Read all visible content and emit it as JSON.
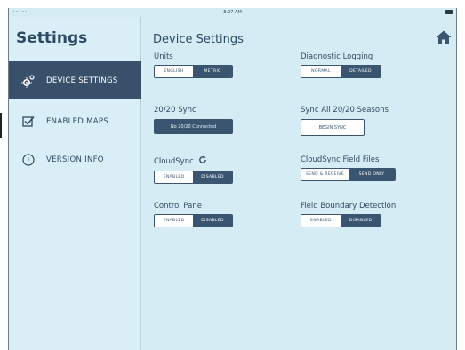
{
  "status_bar": {
    "signal": "•••••  ",
    "time": "8:27 AM"
  },
  "sidebar": {
    "title": "Settings",
    "items": [
      {
        "label": "DEVICE SETTINGS",
        "icon": "gears-icon",
        "active": true
      },
      {
        "label": "ENABLED MAPS",
        "icon": "checkbox-icon",
        "active": false
      },
      {
        "label": "VERSION INFO",
        "icon": "info-icon",
        "active": false
      }
    ]
  },
  "main": {
    "title": "Device Settings",
    "units": {
      "label": "Units",
      "options": [
        "ENGLISH",
        "METRIC"
      ],
      "selected": "METRIC"
    },
    "diagnostic_logging": {
      "label": "Diagnostic Logging",
      "options": [
        "NORMAL",
        "DETAILED"
      ],
      "selected": "DETAILED"
    },
    "sync_2020": {
      "label": "20/20 Sync",
      "button": "No 20/20 Connected"
    },
    "sync_all": {
      "label": "Sync All 20/20 Seasons",
      "button": "BEGIN SYNC"
    },
    "cloudsync": {
      "label": "CloudSync",
      "options": [
        "ENABLED",
        "DISABLED"
      ],
      "selected": "DISABLED"
    },
    "cloudsync_files": {
      "label": "CloudSync Field Files",
      "options": [
        "SEND & RECEIVE",
        "SEND ONLY"
      ],
      "selected": "SEND ONLY"
    },
    "control_pane": {
      "label": "Control Pane",
      "options": [
        "ENABLED",
        "DISABLED"
      ],
      "selected": "DISABLED"
    },
    "field_boundary": {
      "label": "Field Boundary Detection",
      "options": [
        "ENABLED",
        "DISABLED"
      ],
      "selected": "DISABLED"
    }
  },
  "colors": {
    "accent": "#3a5570",
    "background": "#d6ecf5",
    "text": "#2e4a62"
  }
}
